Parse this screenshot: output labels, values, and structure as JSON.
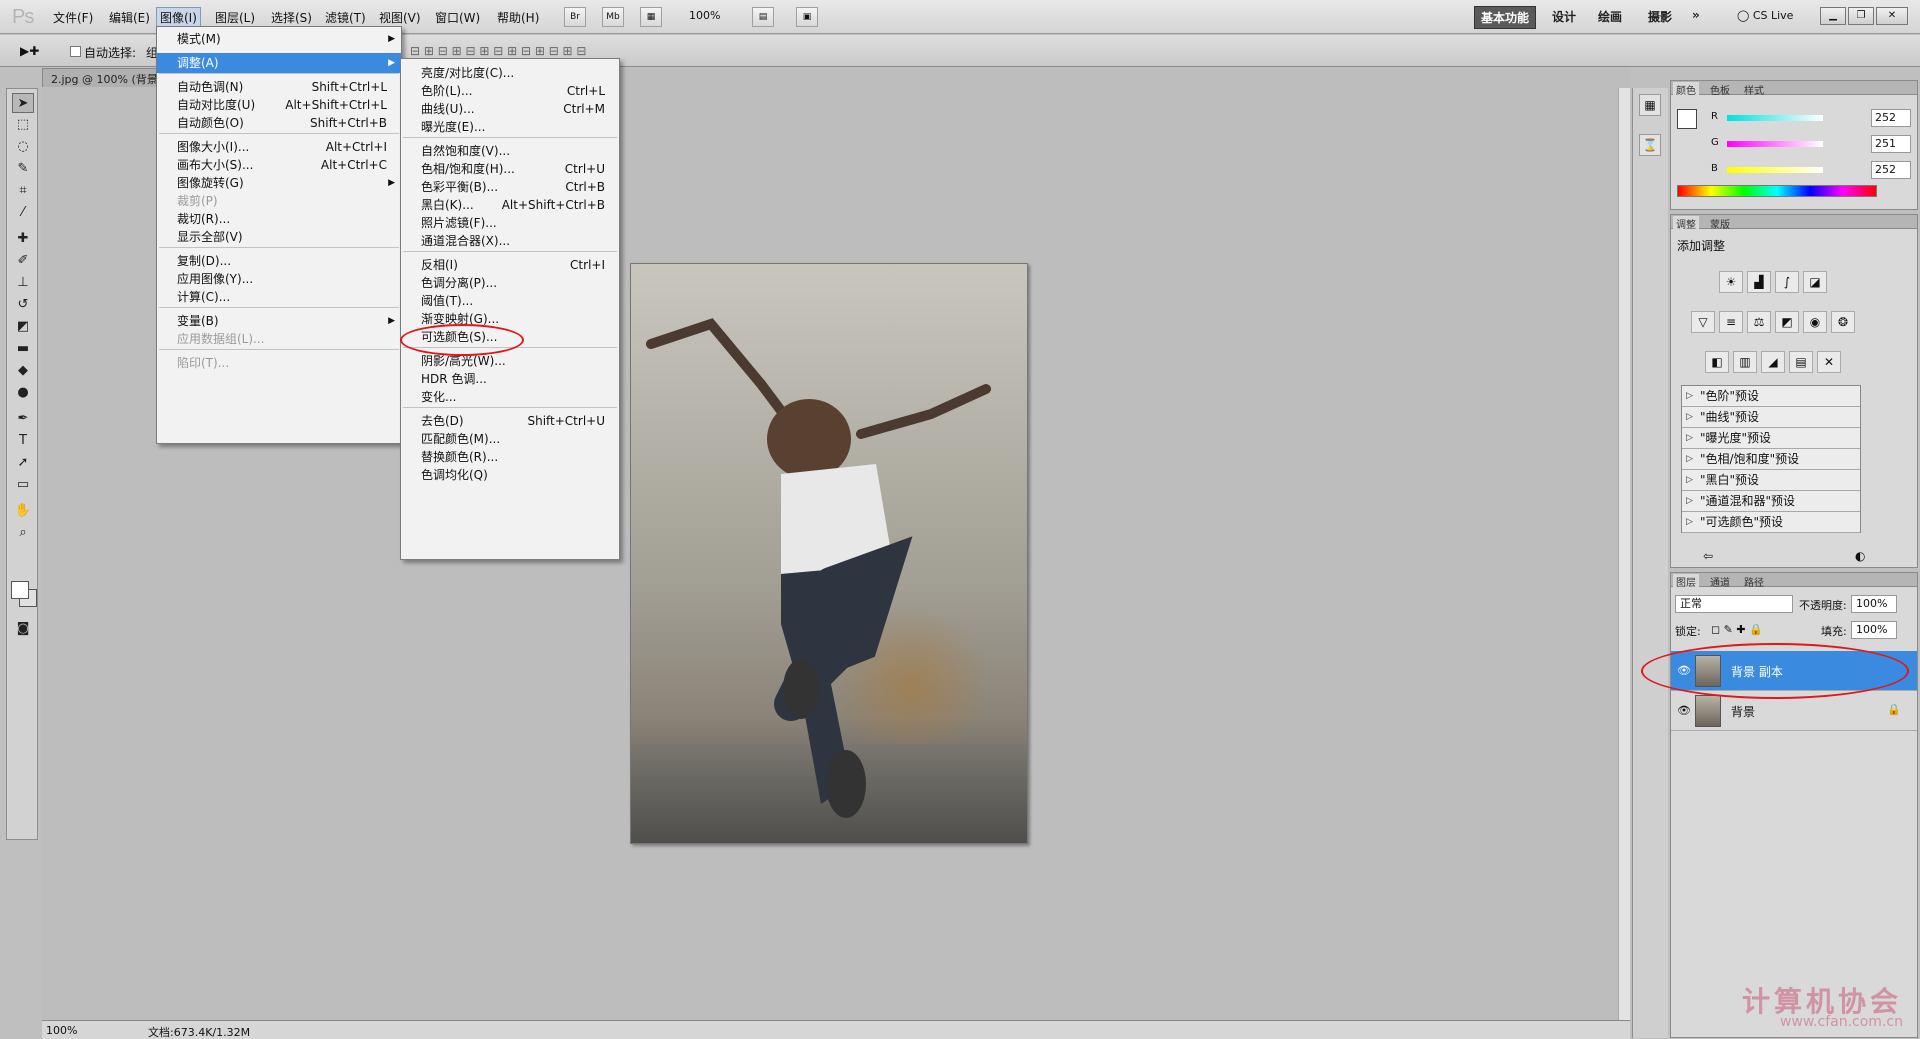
{
  "app": {
    "logo": "Ps"
  },
  "menubar": {
    "items": [
      "文件(F)",
      "编辑(E)",
      "图像(I)",
      "图层(L)",
      "选择(S)",
      "滤镜(T)",
      "视图(V)",
      "窗口(W)",
      "帮助(H)"
    ],
    "br": "Br",
    "mb": "Mb",
    "zoom": "100%",
    "workspaces": [
      "基本功能",
      "设计",
      "绘画",
      "摄影"
    ],
    "more": "»",
    "cs_live": "CS Live"
  },
  "options": {
    "auto_select_label": "自动选择:",
    "auto_select_value": "组"
  },
  "document": {
    "tab_title": "2.jpg @ 100% (背景",
    "status_zoom": "100%",
    "status_doc": "文档:673.4K/1.32M"
  },
  "image_menu": {
    "items": [
      {
        "label": "模式(M)",
        "shortcut": "",
        "arrow": true
      },
      {
        "label": "调整(A)",
        "shortcut": "",
        "arrow": true,
        "highlighted": true
      },
      {
        "label": "自动色调(N)",
        "shortcut": "Shift+Ctrl+L"
      },
      {
        "label": "自动对比度(U)",
        "shortcut": "Alt+Shift+Ctrl+L"
      },
      {
        "label": "自动颜色(O)",
        "shortcut": "Shift+Ctrl+B"
      },
      {
        "label": "图像大小(I)...",
        "shortcut": "Alt+Ctrl+I"
      },
      {
        "label": "画布大小(S)...",
        "shortcut": "Alt+Ctrl+C"
      },
      {
        "label": "图像旋转(G)",
        "shortcut": "",
        "arrow": true
      },
      {
        "label": "裁剪(P)",
        "shortcut": "",
        "disabled": true
      },
      {
        "label": "裁切(R)...",
        "shortcut": ""
      },
      {
        "label": "显示全部(V)",
        "shortcut": ""
      },
      {
        "label": "复制(D)...",
        "shortcut": ""
      },
      {
        "label": "应用图像(Y)...",
        "shortcut": ""
      },
      {
        "label": "计算(C)...",
        "shortcut": ""
      },
      {
        "label": "变量(B)",
        "shortcut": "",
        "arrow": true
      },
      {
        "label": "应用数据组(L)...",
        "shortcut": "",
        "disabled": true
      },
      {
        "label": "陷印(T)...",
        "shortcut": "",
        "disabled": true
      }
    ]
  },
  "adjust_menu": {
    "items": [
      {
        "label": "亮度/对比度(C)...",
        "shortcut": ""
      },
      {
        "label": "色阶(L)...",
        "shortcut": "Ctrl+L"
      },
      {
        "label": "曲线(U)...",
        "shortcut": "Ctrl+M"
      },
      {
        "label": "曝光度(E)...",
        "shortcut": ""
      },
      {
        "label": "自然饱和度(V)...",
        "shortcut": ""
      },
      {
        "label": "色相/饱和度(H)...",
        "shortcut": "Ctrl+U"
      },
      {
        "label": "色彩平衡(B)...",
        "shortcut": "Ctrl+B"
      },
      {
        "label": "黑白(K)...",
        "shortcut": "Alt+Shift+Ctrl+B"
      },
      {
        "label": "照片滤镜(F)...",
        "shortcut": ""
      },
      {
        "label": "通道混合器(X)...",
        "shortcut": ""
      },
      {
        "label": "反相(I)",
        "shortcut": "Ctrl+I"
      },
      {
        "label": "色调分离(P)...",
        "shortcut": ""
      },
      {
        "label": "阈值(T)...",
        "shortcut": "",
        "circled": true
      },
      {
        "label": "渐变映射(G)...",
        "shortcut": ""
      },
      {
        "label": "可选颜色(S)...",
        "shortcut": ""
      },
      {
        "label": "阴影/高光(W)...",
        "shortcut": ""
      },
      {
        "label": "HDR 色调...",
        "shortcut": ""
      },
      {
        "label": "变化...",
        "shortcut": ""
      },
      {
        "label": "去色(D)",
        "shortcut": "Shift+Ctrl+U"
      },
      {
        "label": "匹配颜色(M)...",
        "shortcut": ""
      },
      {
        "label": "替换颜色(R)...",
        "shortcut": ""
      },
      {
        "label": "色调均化(Q)",
        "shortcut": ""
      }
    ]
  },
  "color_panel": {
    "tabs": [
      "颜色",
      "色板",
      "样式"
    ],
    "channels": [
      {
        "name": "R",
        "value": "252",
        "gradient": "#00e0e0,#ffffff"
      },
      {
        "name": "G",
        "value": "251",
        "gradient": "#ff00ff,#ffffff"
      },
      {
        "name": "B",
        "value": "252",
        "gradient": "#ffff00,#ffffff"
      }
    ]
  },
  "adjustments_panel": {
    "tabs": [
      "调整",
      "蒙版"
    ],
    "title": "添加调整",
    "presets": [
      "\"色阶\"预设",
      "\"曲线\"预设",
      "\"曝光度\"预设",
      "\"色相/饱和度\"预设",
      "\"黑白\"预设",
      "\"通道混和器\"预设",
      "\"可选颜色\"预设"
    ]
  },
  "layers_panel": {
    "tabs": [
      "图层",
      "通道",
      "路径"
    ],
    "blend_mode": "正常",
    "opacity_label": "不透明度:",
    "opacity": "100%",
    "lock_label": "锁定:",
    "fill_label": "填充:",
    "fill": "100%",
    "layers": [
      {
        "name": "背景 副本",
        "selected": true,
        "locked": false
      },
      {
        "name": "背景",
        "selected": false,
        "locked": true
      }
    ]
  },
  "watermark": {
    "title": "计算机协会",
    "url": "www.cfan.com.cn"
  }
}
